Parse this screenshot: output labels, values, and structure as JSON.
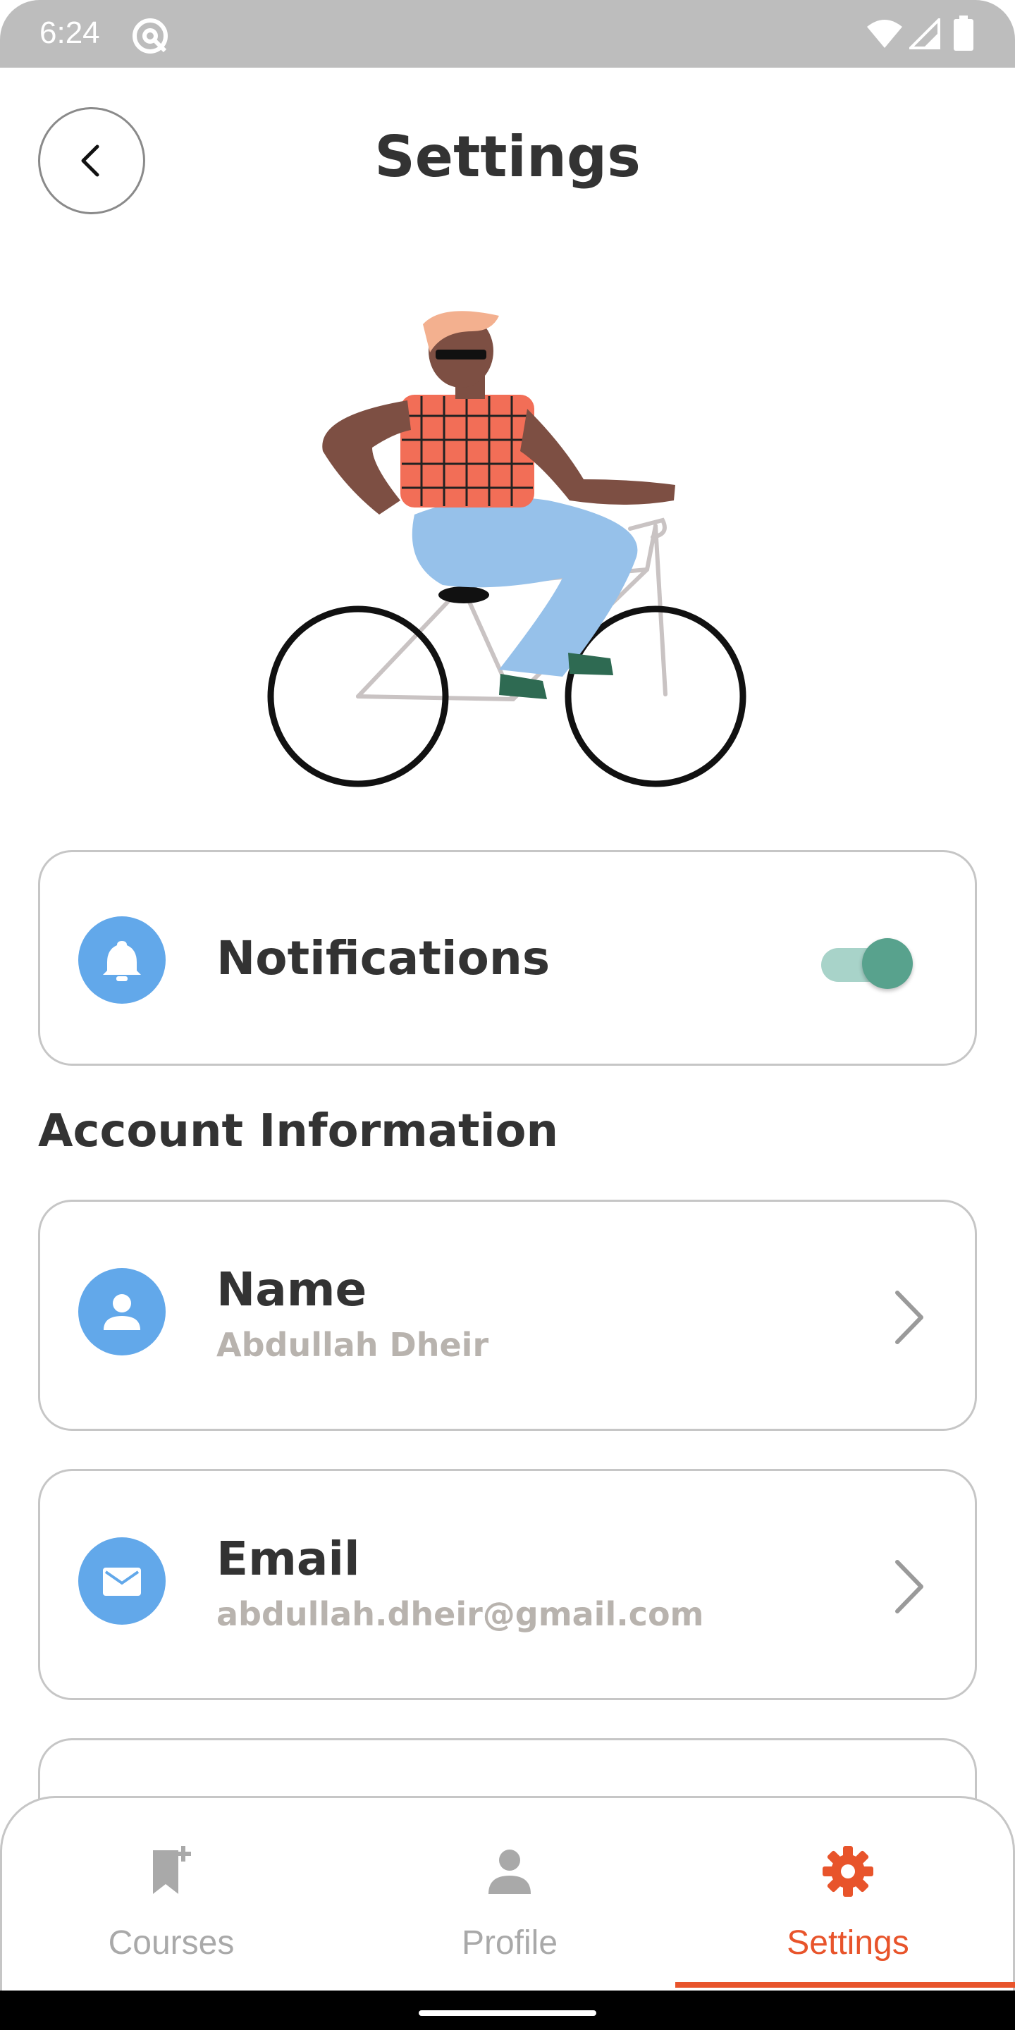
{
  "status_bar": {
    "time": "6:24"
  },
  "header": {
    "title": "Settings"
  },
  "notifications": {
    "label": "Notifications",
    "enabled": true
  },
  "account_section": {
    "title": "Account Information"
  },
  "account_items": [
    {
      "title": "Name",
      "value": "Abdullah Dheir"
    },
    {
      "title": "Email",
      "value": "abdullah.dheir@gmail.com"
    }
  ],
  "bottom_nav": {
    "items": [
      {
        "label": "Courses",
        "icon": "bookmark-add-icon",
        "active": false
      },
      {
        "label": "Profile",
        "icon": "person-icon",
        "active": false
      },
      {
        "label": "Settings",
        "icon": "gear-icon",
        "active": true
      }
    ]
  },
  "colors": {
    "accent": "#e8542b",
    "icon_circle": "#62a8ea",
    "toggle": "#58a28d",
    "inactive": "#a9a9a9"
  }
}
